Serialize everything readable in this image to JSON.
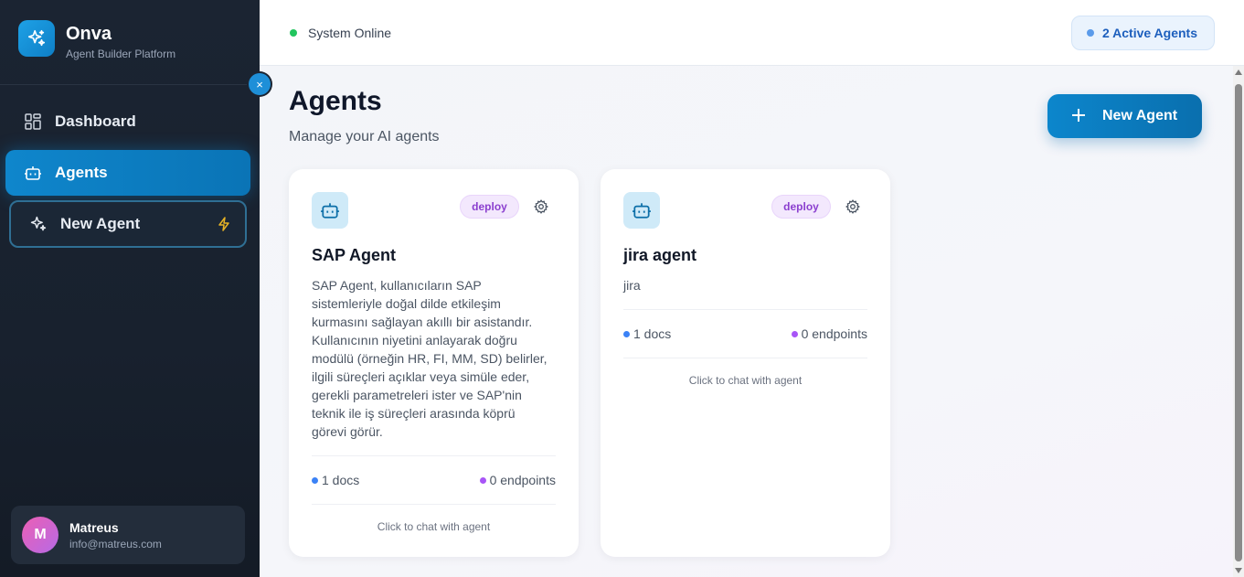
{
  "brand": {
    "name": "Onva",
    "subtitle": "Agent Builder Platform"
  },
  "sidebar": {
    "collapse_label": "×",
    "items": [
      {
        "label": "Dashboard",
        "icon": "grid-icon",
        "active": false
      },
      {
        "label": "Agents",
        "icon": "bot-icon",
        "active": true
      },
      {
        "label": "New Agent",
        "icon": "sparkles-icon",
        "active": false
      }
    ]
  },
  "user": {
    "initial": "M",
    "name": "Matreus",
    "email": "info@matreus.com"
  },
  "header": {
    "status_text": "System Online",
    "active_agents": "2 Active Agents"
  },
  "page": {
    "title": "Agents",
    "subtitle": "Manage your AI agents",
    "new_button": "New Agent"
  },
  "agents": [
    {
      "name": "SAP Agent",
      "badge": "deploy",
      "description": "SAP Agent, kullanıcıların SAP sistemleriyle doğal dilde etkileşim kurmasını sağlayan akıllı bir asistandır. Kullanıcının niyetini anlayarak doğru modülü (örneğin HR, FI, MM, SD) belirler, ilgili süreçleri açıklar veya simüle eder, gerekli parametreleri ister ve SAP'nin teknik ile iş süreçleri arasında köprü görevi görür.",
      "docs": "1 docs",
      "endpoints": "0 endpoints",
      "hint": "Click to chat with agent"
    },
    {
      "name": "jira agent",
      "badge": "deploy",
      "description": "jira",
      "docs": "1 docs",
      "endpoints": "0 endpoints",
      "hint": "Click to chat with agent"
    }
  ],
  "colors": {
    "accent": "#0c86cc",
    "sidebar_bg": "#1b2432",
    "online": "#22c55e",
    "badge_text": "#8b3fcf",
    "docs_dot": "#3b82f6",
    "endpoints_dot": "#a855f7"
  }
}
